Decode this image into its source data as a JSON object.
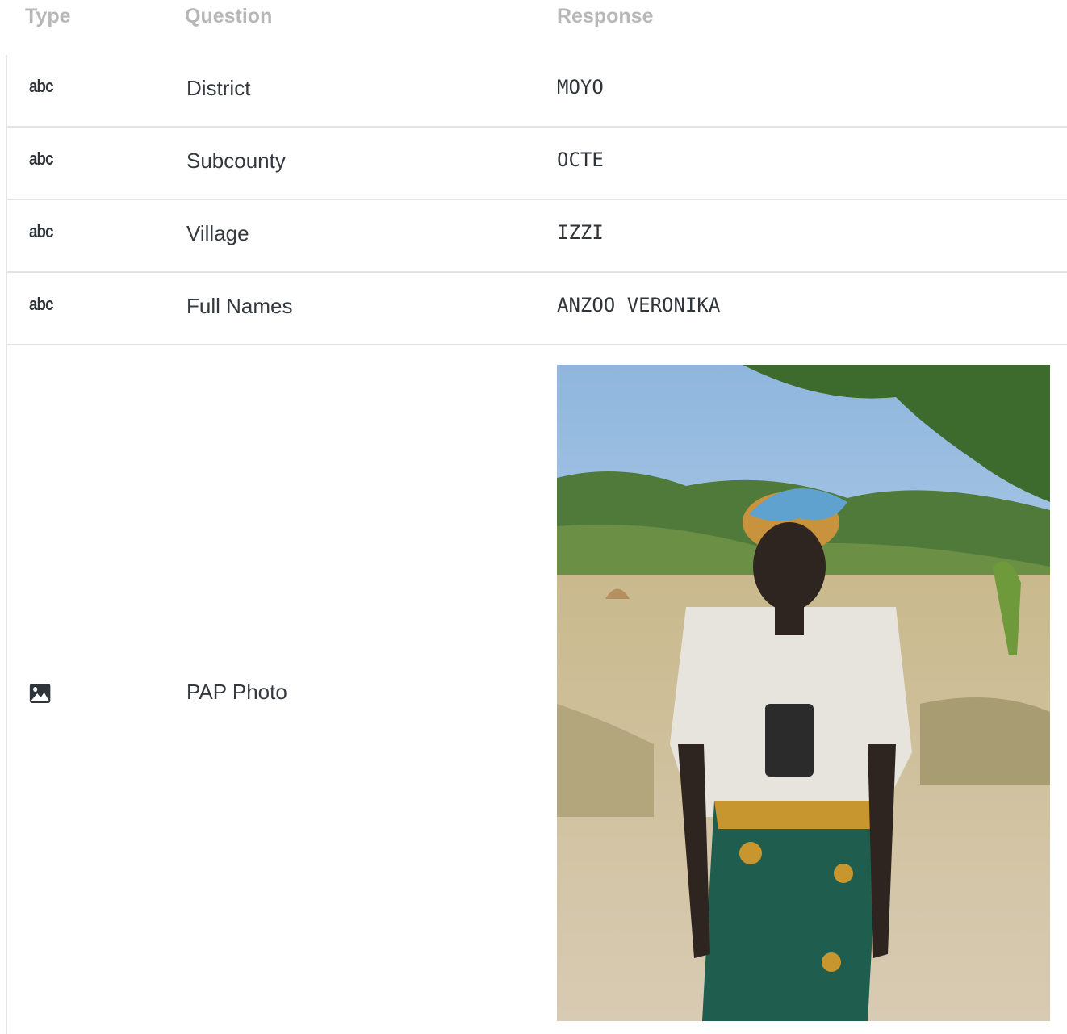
{
  "headers": {
    "type": "Type",
    "question": "Question",
    "response": "Response"
  },
  "rows": [
    {
      "type_icon": "text-type-icon",
      "type_text": "abc",
      "question": "District",
      "response": "MOYO"
    },
    {
      "type_icon": "text-type-icon",
      "type_text": "abc",
      "question": "Subcounty",
      "response": "OCTE"
    },
    {
      "type_icon": "text-type-icon",
      "type_text": "abc",
      "question": "Village",
      "response": "IZZI"
    },
    {
      "type_icon": "text-type-icon",
      "type_text": "abc",
      "question": "Full Names",
      "response": "ANZOO VERONIKA"
    },
    {
      "type_icon": "image-icon",
      "question": "PAP Photo",
      "response_image": "photo of person standing in field"
    }
  ]
}
